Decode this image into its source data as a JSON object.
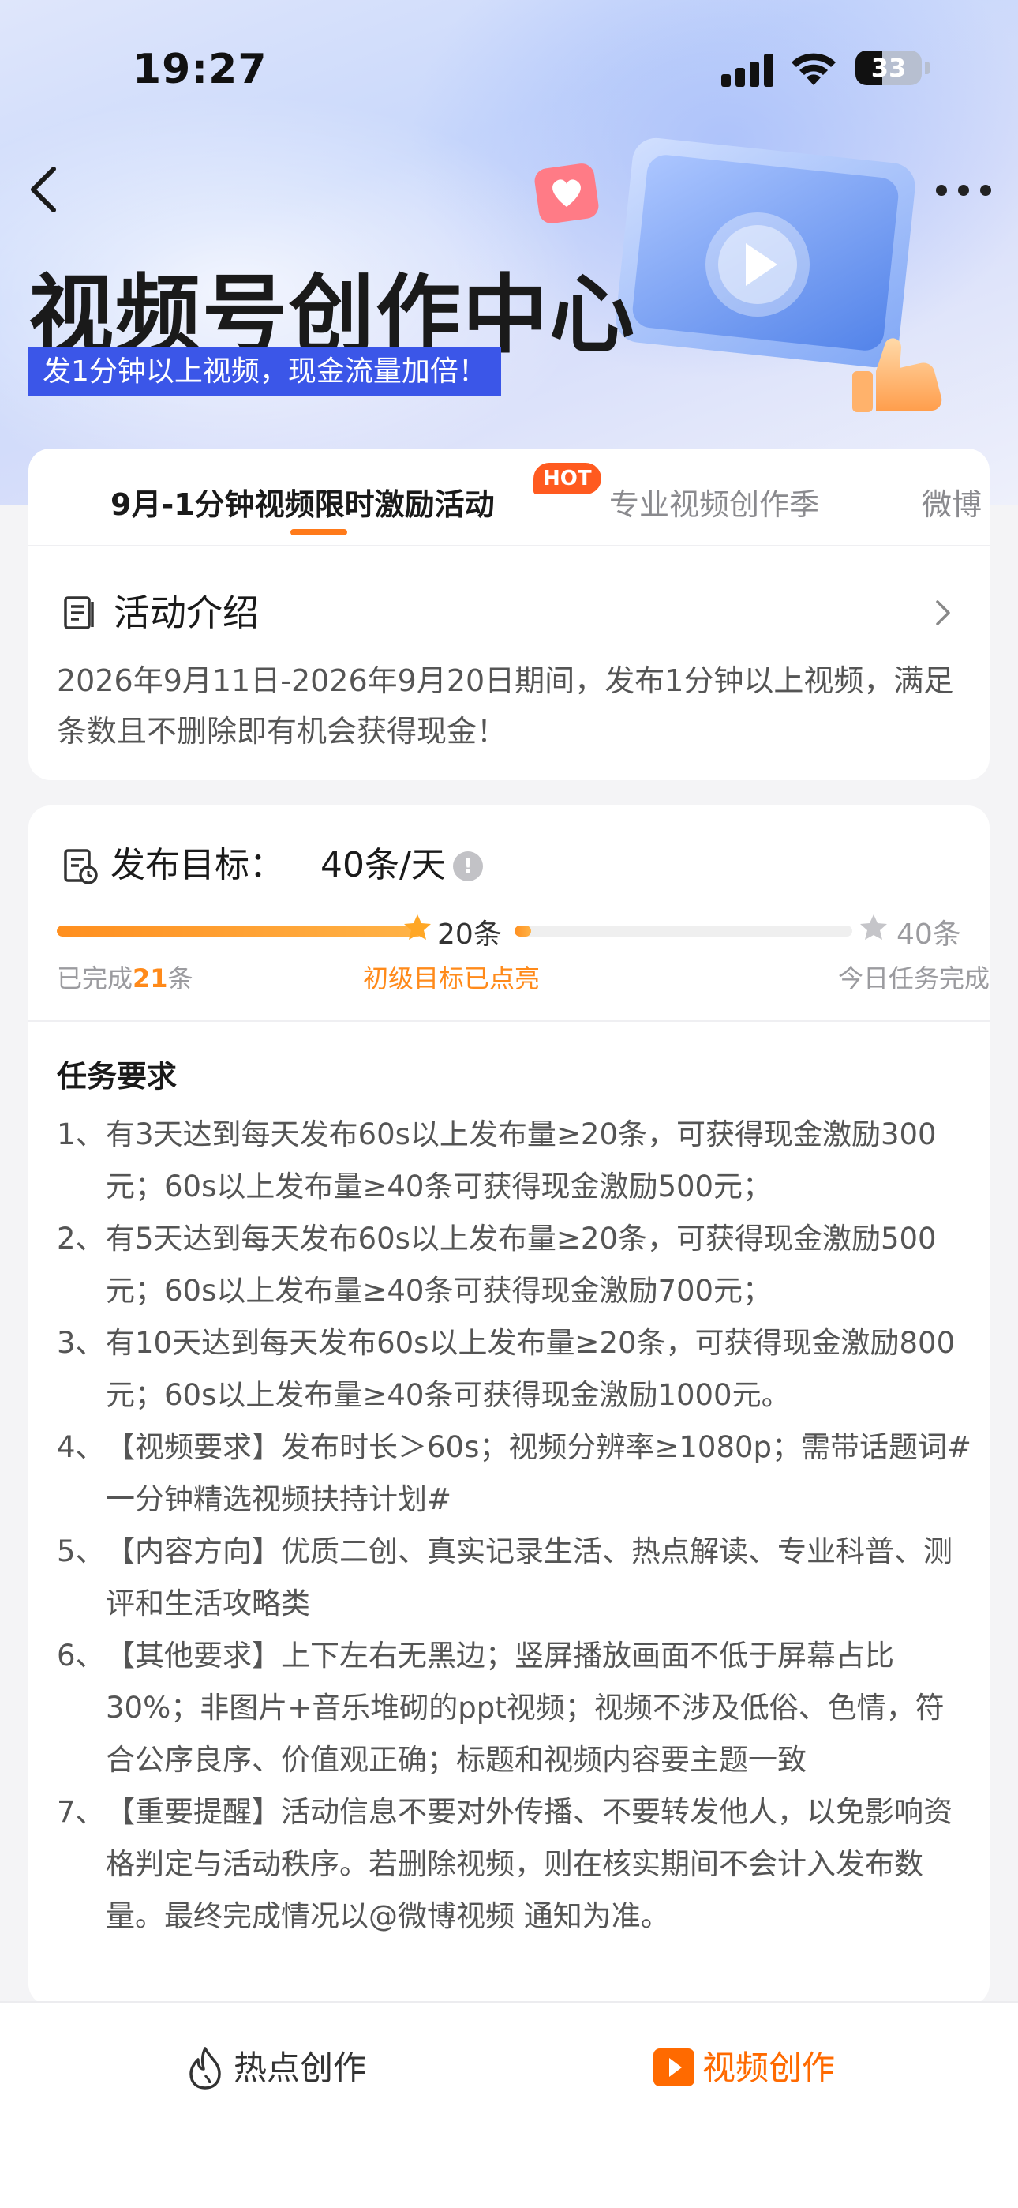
{
  "status": {
    "time": "19:27",
    "battery": "33"
  },
  "header": {
    "title": "视频号创作中心",
    "subtitle": "发1分钟以上视频，现金流量加倍！"
  },
  "tabs": [
    {
      "label": "9月-1分钟视频限时激励活动",
      "badge": "HOT",
      "active": true
    },
    {
      "label": "专业视频创作季",
      "active": false
    },
    {
      "label": "微博",
      "active": false
    }
  ],
  "intro": {
    "title": "活动介绍",
    "body": "2026年9月11日-2026年9月20日期间，发布1分钟以上视频，满足条数且不删除即有机会获得现金！"
  },
  "goal": {
    "title_prefix": "发布目标：",
    "title_value": "40条/天",
    "info_glyph": "!",
    "milestone_1": "20条",
    "milestone_2": "40条",
    "segment_1_progress": 1.0,
    "segment_2_progress": 0.05,
    "completed_prefix": "已完成",
    "completed_count": "21",
    "completed_suffix": "条",
    "level_status": "初级目标已点亮",
    "today_status": "今日任务完成"
  },
  "requirements": {
    "title": "任务要求",
    "items": [
      {
        "num": "1、",
        "text": "有3天达到每天发布60s以上发布量≥20条，可获得现金激励300元；60s以上发布量≥40条可获得现金激励500元；"
      },
      {
        "num": "2、",
        "text": "有5天达到每天发布60s以上发布量≥20条，可获得现金激励500元；60s以上发布量≥40条可获得现金激励700元；"
      },
      {
        "num": "3、",
        "text": "有10天达到每天发布60s以上发布量≥20条，可获得现金激励800元；60s以上发布量≥40条可获得现金激励1000元。"
      },
      {
        "num": "4、",
        "text": "【视频要求】发布时长＞60s；视频分辨率≥1080p；需带话题词#一分钟精选视频扶持计划#"
      },
      {
        "num": "5、",
        "text": "【内容方向】优质二创、真实记录生活、热点解读、专业科普、测评和生活攻略类"
      },
      {
        "num": "6、",
        "text": "【其他要求】上下左右无黑边；竖屏播放画面不低于屏幕占比30%；非图片+音乐堆砌的ppt视频；视频不涉及低俗、色情，符合公序良序、价值观正确；标题和视频内容要主题一致"
      },
      {
        "num": "7、",
        "text": "【重要提醒】活动信息不要对外传播、不要转发他人，以免影响资格判定与活动秩序。若删除视频，则在核实期间不会计入发布数量。最终完成情况以@微博视频 通知为准。"
      }
    ]
  },
  "bottom_nav": {
    "left_label": "热点创作",
    "right_label": "视频创作"
  },
  "colors": {
    "accent": "#ff7a1a",
    "badge_blue": "#3b56e8",
    "hot": "#ff5a1f"
  }
}
